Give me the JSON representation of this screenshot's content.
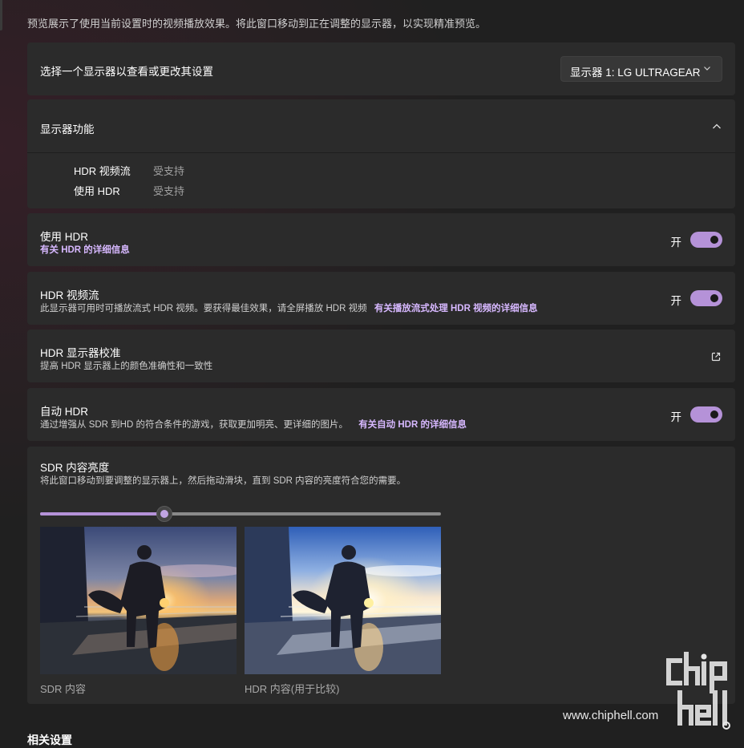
{
  "intro_text": "预览展示了使用当前设置时的视频播放效果。将此窗口移动到正在调整的显示器，以实现精准预览。",
  "display_select": {
    "label": "选择一个显示器以查看或更改其设置",
    "selected": "显示器 1: LG ULTRAGEAR"
  },
  "capabilities": {
    "title": "显示器功能",
    "items": [
      {
        "name": "HDR 视频流",
        "value": "受支持"
      },
      {
        "name": "使用 HDR",
        "value": "受支持"
      }
    ]
  },
  "use_hdr": {
    "title": "使用 HDR",
    "link": "有关 HDR 的详细信息",
    "state": "开",
    "on": true
  },
  "hdr_streaming": {
    "title": "HDR 视频流",
    "desc": "此显示器可用时可播放流式 HDR 视频。要获得最佳效果，请全屏播放 HDR 视频",
    "link": "有关播放流式处理 HDR 视频的详细信息",
    "state": "开",
    "on": true
  },
  "calibration": {
    "title": "HDR 显示器校准",
    "desc": "提高 HDR 显示器上的颜色准确性和一致性",
    "icon": "external-link-icon"
  },
  "auto_hdr": {
    "title": "自动 HDR",
    "desc": "通过增强从 SDR 到HD 的符合条件的游戏，获取更加明亮、更详细的图片。",
    "link": "有关自动 HDR 的详细信息",
    "state": "开",
    "on": true
  },
  "sdr_brightness": {
    "title": "SDR 内容亮度",
    "desc": "将此窗口移动到要调整的显示器上，然后拖动滑块，直到 SDR 内容的亮度符合您的需要。",
    "slider_fraction": 0.31,
    "previews": [
      {
        "caption": "SDR 内容"
      },
      {
        "caption": "HDR 内容(用于比较)"
      }
    ]
  },
  "related_heading": "相关设置",
  "watermark": {
    "text": "www.chiphell.com",
    "logo": "chiphell-logo"
  },
  "colors": {
    "accent": "#b592d8",
    "link": "#d7b8ff",
    "card": "#2b2b2b",
    "background": "#202020"
  }
}
